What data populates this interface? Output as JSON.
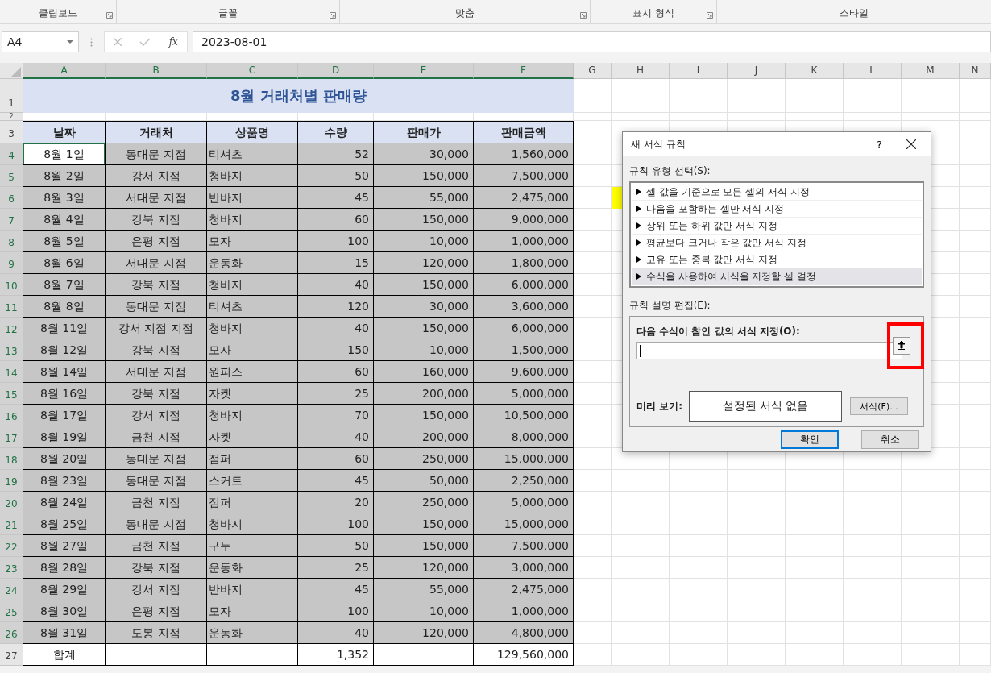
{
  "ribbon": {
    "groups": [
      {
        "label": "클립보드",
        "launcher": true
      },
      {
        "label": "글꼴",
        "launcher": true
      },
      {
        "label": "맞춤",
        "launcher": true
      },
      {
        "label": "표시 형식",
        "launcher": true
      },
      {
        "label": "스타일",
        "launcher": false
      }
    ]
  },
  "formula_bar": {
    "name_box": "A4",
    "fx": "fx",
    "value": "2023-08-01"
  },
  "sheet": {
    "columns": [
      {
        "label": "A",
        "selected": true
      },
      {
        "label": "B",
        "selected": true
      },
      {
        "label": "C",
        "selected": true
      },
      {
        "label": "D",
        "selected": true
      },
      {
        "label": "E",
        "selected": true
      },
      {
        "label": "F",
        "selected": true
      },
      {
        "label": "G",
        "selected": false
      },
      {
        "label": "H",
        "selected": false
      },
      {
        "label": "I",
        "selected": false
      },
      {
        "label": "J",
        "selected": false
      },
      {
        "label": "K",
        "selected": false
      },
      {
        "label": "L",
        "selected": false
      },
      {
        "label": "M",
        "selected": false
      },
      {
        "label": "N",
        "selected": false
      }
    ],
    "top_rows": [
      "1",
      "2",
      "3"
    ],
    "title": "8월 거래처별 판매량",
    "headers": [
      "날짜",
      "거래처",
      "상품명",
      "수량",
      "판매가",
      "판매금액"
    ],
    "rows": [
      {
        "num": "4",
        "cells": [
          "8월 1일",
          "동대문 지점",
          "티셔츠",
          "52",
          "30,000",
          "1,560,000"
        ],
        "selected": true,
        "active": true,
        "marked": false
      },
      {
        "num": "5",
        "cells": [
          "8월 2일",
          "강서 지점",
          "청바지",
          "50",
          "150,000",
          "7,500,000"
        ],
        "selected": true,
        "active": false,
        "marked": false
      },
      {
        "num": "6",
        "cells": [
          "8월 3일",
          "서대문 지점",
          "반바지",
          "45",
          "55,000",
          "2,475,000"
        ],
        "selected": true,
        "active": false,
        "marked": true
      },
      {
        "num": "7",
        "cells": [
          "8월 4일",
          "강북 지점",
          "청바지",
          "60",
          "150,000",
          "9,000,000"
        ],
        "selected": true,
        "active": false,
        "marked": false
      },
      {
        "num": "8",
        "cells": [
          "8월 5일",
          "은평 지점",
          "모자",
          "100",
          "10,000",
          "1,000,000"
        ],
        "selected": true,
        "active": false,
        "marked": false
      },
      {
        "num": "9",
        "cells": [
          "8월 6일",
          "서대문 지점",
          "운동화",
          "15",
          "120,000",
          "1,800,000"
        ],
        "selected": true,
        "active": false,
        "marked": false
      },
      {
        "num": "10",
        "cells": [
          "8월 7일",
          "강북 지점",
          "청바지",
          "40",
          "150,000",
          "6,000,000"
        ],
        "selected": true,
        "active": false,
        "marked": false
      },
      {
        "num": "11",
        "cells": [
          "8월 8일",
          "동대문 지점",
          "티셔츠",
          "120",
          "30,000",
          "3,600,000"
        ],
        "selected": true,
        "active": false,
        "marked": false
      },
      {
        "num": "12",
        "cells": [
          "8월 11일",
          "강서 지점 지점",
          "청바지",
          "40",
          "150,000",
          "6,000,000"
        ],
        "selected": true,
        "active": false,
        "marked": false
      },
      {
        "num": "13",
        "cells": [
          "8월 12일",
          "강북 지점",
          "모자",
          "150",
          "10,000",
          "1,500,000"
        ],
        "selected": true,
        "active": false,
        "marked": false
      },
      {
        "num": "14",
        "cells": [
          "8월 14일",
          "서대문 지점",
          "원피스",
          "60",
          "160,000",
          "9,600,000"
        ],
        "selected": true,
        "active": false,
        "marked": false
      },
      {
        "num": "15",
        "cells": [
          "8월 16일",
          "강북 지점",
          "자켓",
          "25",
          "200,000",
          "5,000,000"
        ],
        "selected": true,
        "active": false,
        "marked": false
      },
      {
        "num": "16",
        "cells": [
          "8월 17일",
          "강서 지점",
          "청바지",
          "70",
          "150,000",
          "10,500,000"
        ],
        "selected": true,
        "active": false,
        "marked": false
      },
      {
        "num": "17",
        "cells": [
          "8월 19일",
          "금천 지점",
          "자켓",
          "40",
          "200,000",
          "8,000,000"
        ],
        "selected": true,
        "active": false,
        "marked": false
      },
      {
        "num": "18",
        "cells": [
          "8월 20일",
          "동대문 지점",
          "점퍼",
          "60",
          "250,000",
          "15,000,000"
        ],
        "selected": true,
        "active": false,
        "marked": false
      },
      {
        "num": "19",
        "cells": [
          "8월 23일",
          "동대문 지점",
          "스커트",
          "45",
          "50,000",
          "2,250,000"
        ],
        "selected": true,
        "active": false,
        "marked": false
      },
      {
        "num": "20",
        "cells": [
          "8월 24일",
          "금천 지점",
          "점퍼",
          "20",
          "250,000",
          "5,000,000"
        ],
        "selected": true,
        "active": false,
        "marked": false
      },
      {
        "num": "21",
        "cells": [
          "8월 25일",
          "동대문 지점",
          "청바지",
          "100",
          "150,000",
          "15,000,000"
        ],
        "selected": true,
        "active": false,
        "marked": false
      },
      {
        "num": "22",
        "cells": [
          "8월 27일",
          "금천 지점",
          "구두",
          "50",
          "150,000",
          "7,500,000"
        ],
        "selected": true,
        "active": false,
        "marked": false
      },
      {
        "num": "23",
        "cells": [
          "8월 28일",
          "강북 지점",
          "운동화",
          "25",
          "120,000",
          "3,000,000"
        ],
        "selected": true,
        "active": false,
        "marked": false
      },
      {
        "num": "24",
        "cells": [
          "8월 29일",
          "강서 지점",
          "반바지",
          "45",
          "55,000",
          "2,475,000"
        ],
        "selected": true,
        "active": false,
        "marked": false
      },
      {
        "num": "25",
        "cells": [
          "8월 30일",
          "은평 지점",
          "모자",
          "100",
          "10,000",
          "1,000,000"
        ],
        "selected": true,
        "active": false,
        "marked": false
      },
      {
        "num": "26",
        "cells": [
          "8월 31일",
          "도봉 지점",
          "운동화",
          "40",
          "120,000",
          "4,800,000"
        ],
        "selected": true,
        "active": false,
        "marked": false
      },
      {
        "num": "27",
        "cells": [
          "합계",
          "",
          "",
          "1,352",
          "",
          "129,560,000"
        ],
        "selected": false,
        "active": false,
        "marked": false
      }
    ]
  },
  "dialog": {
    "title": "새 서식 규칙",
    "help": "?",
    "rule_type_label": "규칙 유형 선택(S):",
    "rule_types": [
      {
        "label": "셀 값을 기준으로 모든 셀의 서식 지정",
        "selected": false
      },
      {
        "label": "다음을 포함하는 셀만 서식 지정",
        "selected": false
      },
      {
        "label": "상위 또는 하위 값만 서식 지정",
        "selected": false
      },
      {
        "label": "평균보다 크거나 작은 값만 서식 지정",
        "selected": false
      },
      {
        "label": "고유 또는 중복 값만 서식 지정",
        "selected": false
      },
      {
        "label": "수식을 사용하여 서식을 지정할 셀 결정",
        "selected": true
      }
    ],
    "edit_label": "규칙 설명 편집(E):",
    "formula_label": "다음 수식이 참인 값의 서식 지정(O):",
    "collapse_highlighted": true,
    "preview_label": "미리 보기:",
    "preview_text": "설정된 서식 없음",
    "format_button": "서식(F)...",
    "buttons": [
      {
        "label": "확인",
        "default": true
      },
      {
        "label": "취소",
        "default": false
      }
    ]
  }
}
